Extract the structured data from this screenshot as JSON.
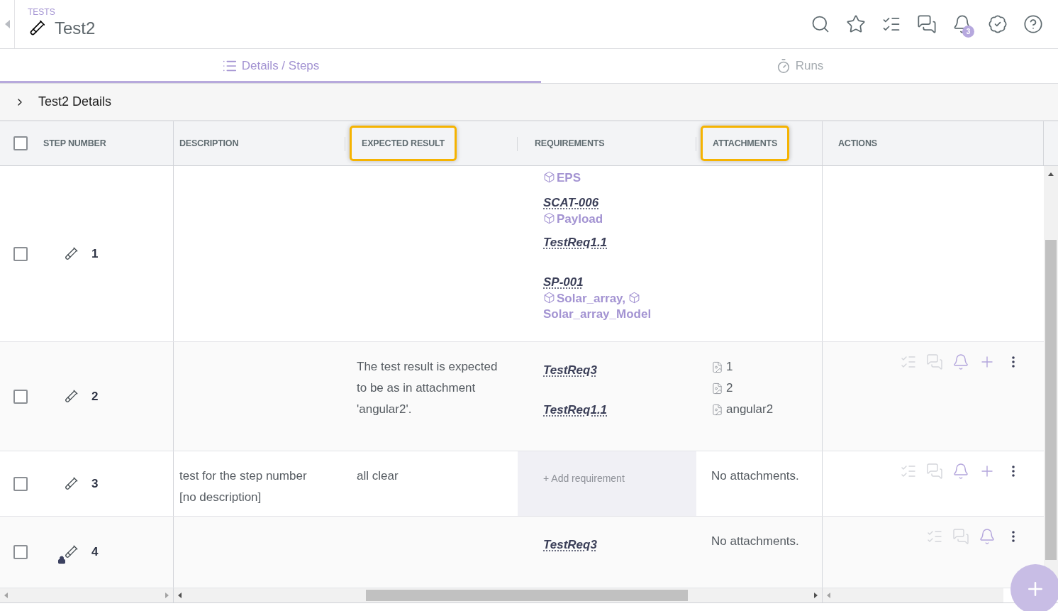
{
  "header": {
    "breadcrumb": "TESTS",
    "title": "Test2",
    "notification_count": "3"
  },
  "toolbar": [
    {
      "kind": "search"
    },
    {
      "kind": "star"
    },
    {
      "kind": "checklist"
    },
    {
      "kind": "chat"
    },
    {
      "kind": "bell"
    },
    {
      "kind": "badge"
    },
    {
      "kind": "help"
    }
  ],
  "tabs": [
    {
      "label": "Details / Steps",
      "kind": "list",
      "selected": true
    },
    {
      "label": "Runs",
      "kind": "timer",
      "selected": false
    }
  ],
  "section": {
    "title": "Test2 Details",
    "expanded": false
  },
  "table": {
    "select_all": {
      "checked": false
    },
    "columns": [
      {
        "label": "STEP NUMBER",
        "highlighted": false
      },
      {
        "label": "DESCRIPTION",
        "highlighted": false
      },
      {
        "label": "EXPECTED RESULT",
        "highlighted": true
      },
      {
        "label": "REQUIREMENTS",
        "highlighted": false
      },
      {
        "label": "ATTACHMENTS",
        "highlighted": true
      },
      {
        "label": "ACTIONS",
        "highlighted": false
      }
    ],
    "rows": [
      {
        "step": "1",
        "checked": false,
        "locked": false,
        "requirements": [
          {
            "components": [
              "EPS"
            ]
          },
          {
            "id": "SCAT-006",
            "components": [
              "Payload"
            ]
          },
          {
            "id": "TestReq1.1"
          },
          {
            "id": "SP-001",
            "components": [
              "Solar_array,",
              "Solar_array_Model"
            ]
          }
        ]
      },
      {
        "step": "2",
        "checked": false,
        "locked": false,
        "expected_result": "The test result is expected to be as in attachment 'angular2'.",
        "requirements": [
          {
            "id": "TestReq3"
          },
          {
            "id": "TestReq1.1"
          }
        ],
        "attachments": [
          "1",
          "2",
          "angular2"
        ],
        "actions": [
          {
            "kind": "checklist",
            "disabled": true
          },
          {
            "kind": "chat",
            "disabled": true
          },
          {
            "kind": "bell",
            "disabled": false
          },
          {
            "kind": "add",
            "disabled": false
          },
          {
            "kind": "more"
          }
        ]
      },
      {
        "step": "3",
        "checked": false,
        "locked": false,
        "description": [
          "test for the step number",
          "[no description]"
        ],
        "expected_result": "all clear",
        "add_requirement": "+ Add requirement",
        "attachments_note": "No attachments.",
        "actions": [
          {
            "kind": "checklist",
            "disabled": true
          },
          {
            "kind": "chat",
            "disabled": true
          },
          {
            "kind": "bell",
            "disabled": false
          },
          {
            "kind": "add",
            "disabled": false
          },
          {
            "kind": "more"
          }
        ]
      },
      {
        "step": "4",
        "checked": false,
        "locked": true,
        "requirements": [
          {
            "id": "TestReq3"
          }
        ],
        "attachments_note": "No attachments.",
        "actions": [
          {
            "kind": "checklist",
            "disabled": true
          },
          {
            "kind": "chat",
            "disabled": true
          },
          {
            "kind": "bell",
            "disabled": false
          },
          {
            "kind": "more"
          }
        ]
      }
    ]
  }
}
